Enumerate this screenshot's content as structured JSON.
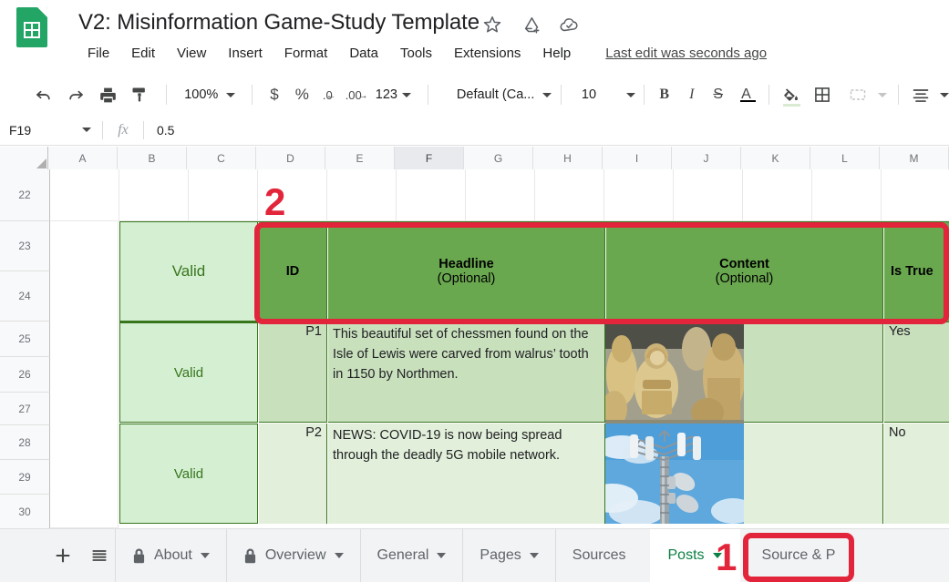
{
  "app": {
    "doc_title": "V2: Misinformation Game-Study Template",
    "logo_icon": "google-sheets-logo",
    "title_icons": [
      "star-icon",
      "move-to-drive-icon",
      "document-status-cloud-icon"
    ],
    "last_edit": "Last edit was seconds ago"
  },
  "menubar": {
    "items": [
      "File",
      "Edit",
      "View",
      "Insert",
      "Format",
      "Data",
      "Tools",
      "Extensions",
      "Help"
    ]
  },
  "toolbar": {
    "undo_icon": "undo-icon",
    "redo_icon": "redo-icon",
    "print_icon": "print-icon",
    "paint_format_icon": "paint-format-icon",
    "zoom_value": "100%",
    "currency_label": "$",
    "percent_label": "%",
    "decrease_decimal_label": ".0",
    "increase_decimal_label": ".00",
    "more_formats_label": "123",
    "font_family_value": "Default (Ca...",
    "font_size_value": "10",
    "bold_label": "B",
    "italic_label": "I",
    "strikethrough_label": "S",
    "text_color_label": "A",
    "fill_color_icon": "fill-color-icon",
    "borders_icon": "borders-icon",
    "merge_cells_icon": "merge-cells-icon",
    "horizontal_align_icon": "horizontal-align-icon"
  },
  "formula_bar": {
    "name_box": "F19",
    "fx_label": "fx",
    "value": "0.5"
  },
  "grid": {
    "columns": [
      "A",
      "B",
      "C",
      "D",
      "E",
      "F",
      "G",
      "H",
      "I",
      "J",
      "K",
      "L",
      "M"
    ],
    "selected_column": "F",
    "rows": [
      "22",
      "23",
      "24",
      "25",
      "26",
      "27",
      "28",
      "29",
      "30"
    ]
  },
  "table": {
    "validation_label_1": "Valid",
    "validation_label_2": "Valid",
    "validation_label_3": "Valid",
    "headers": {
      "id": {
        "title": "ID",
        "sub": ""
      },
      "headline": {
        "title": "Headline",
        "sub": "(Optional)"
      },
      "content": {
        "title": "Content",
        "sub": "(Optional)"
      },
      "is_true": {
        "title": "Is True",
        "sub": ""
      }
    },
    "posts": [
      {
        "id": "P1",
        "headline": "This beautiful set of chessmen found on the Isle of Lewis were carved from walrus’ tooth in 1150 by Northmen.",
        "image": "lewis-chessmen-photo",
        "is_true": "Yes"
      },
      {
        "id": "P2",
        "headline": "NEWS: COVID-19 is now being spread through the deadly 5G mobile network.",
        "image": "cell-tower-photo",
        "is_true": "No"
      }
    ]
  },
  "annotations": [
    {
      "label": "1",
      "target": "posts-sheet-tab"
    },
    {
      "label": "2",
      "target": "table-header-row"
    }
  ],
  "sheet_tabs": {
    "add_sheet_icon": "plus-icon",
    "all_sheets_icon": "list-icon",
    "tabs": [
      {
        "label": "About",
        "locked": true,
        "active": false
      },
      {
        "label": "Overview",
        "locked": true,
        "active": false
      },
      {
        "label": "General",
        "locked": false,
        "active": false
      },
      {
        "label": "Pages",
        "locked": false,
        "active": false
      },
      {
        "label": "Sources",
        "locked": false,
        "active": false,
        "no_caret": true
      },
      {
        "label": "Posts",
        "locked": false,
        "active": true
      },
      {
        "label": "Source & P",
        "locked": false,
        "active": false,
        "no_caret": true
      }
    ]
  },
  "colors": {
    "brand_green": "#23a566",
    "header_green": "#6aa84f",
    "light_green": "#d9ead3",
    "valid_green": "#d4efd2",
    "valid_text": "#38761d",
    "annotation_red": "#e2253a",
    "active_tab_text": "#0b8043"
  }
}
